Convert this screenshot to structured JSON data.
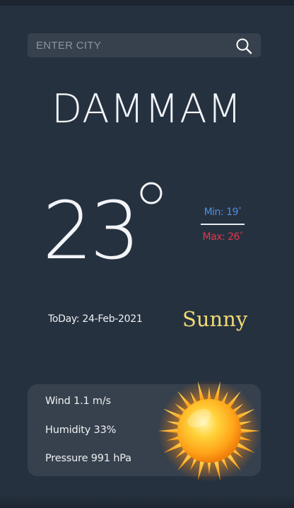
{
  "search": {
    "placeholder": "ENTER CITY",
    "button_icon": "search-icon"
  },
  "weather": {
    "city": "DAMMAM",
    "temperature": "23",
    "min_label": "Min: 19",
    "max_label": "Max: 26",
    "date_label": "ToDay: 24-Feb-2021",
    "condition": "Sunny",
    "condition_icon": "sun-icon"
  },
  "details": {
    "wind": "Wind 1.1 m/s",
    "humidity": "Humidity 33%",
    "pressure": "Pressure 991 hPa"
  },
  "colors": {
    "background": "#263140",
    "card": "#37414d",
    "min_color": "#4a90e2",
    "max_color": "#e0374a",
    "condition_color": "#eeda73"
  }
}
